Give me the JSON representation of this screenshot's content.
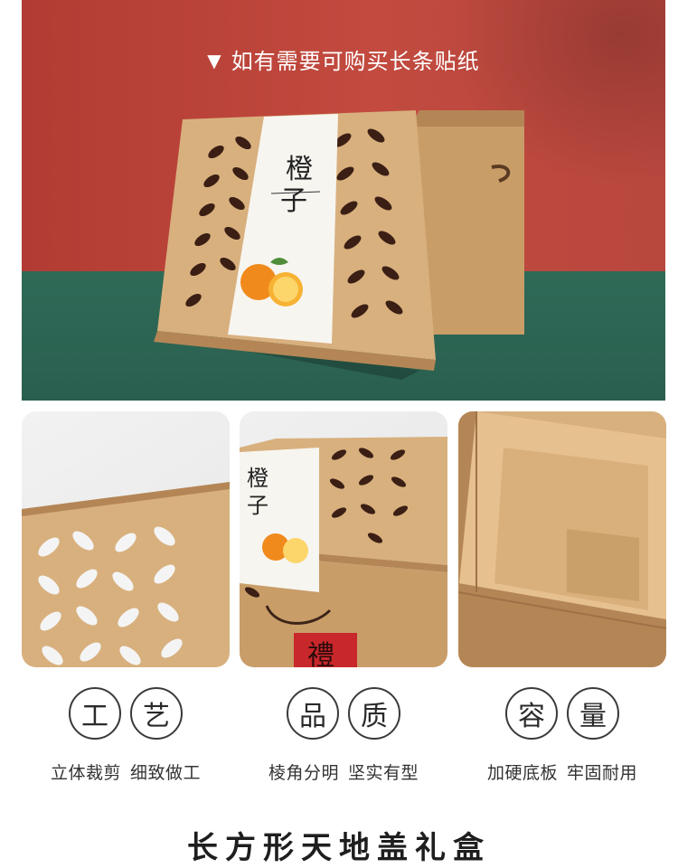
{
  "hero": {
    "caption_icon": "down-triangle-icon",
    "caption_marker": "▼",
    "caption": "如有需要可购买长条贴纸",
    "label_title_top": "橙",
    "label_title_bottom": "子",
    "colors": {
      "wall": "#b23c33",
      "floor": "#2f6a57",
      "kraft": "#c99d68"
    }
  },
  "panels": [
    {
      "id": "die-cut-detail"
    },
    {
      "id": "box-with-label",
      "label_title_top": "橙",
      "label_title_bottom": "子",
      "stamp_char": "禮"
    },
    {
      "id": "open-box-interior"
    }
  ],
  "features": [
    {
      "chars": [
        "工",
        "艺"
      ],
      "desc_1": "立体裁剪",
      "desc_2": "细致做工"
    },
    {
      "chars": [
        "品",
        "质"
      ],
      "desc_1": "棱角分明",
      "desc_2": "坚实有型"
    },
    {
      "chars": [
        "容",
        "量"
      ],
      "desc_1": "加硬底板",
      "desc_2": "牢固耐用"
    }
  ],
  "footer": {
    "title": "长方形天地盖礼盒"
  }
}
